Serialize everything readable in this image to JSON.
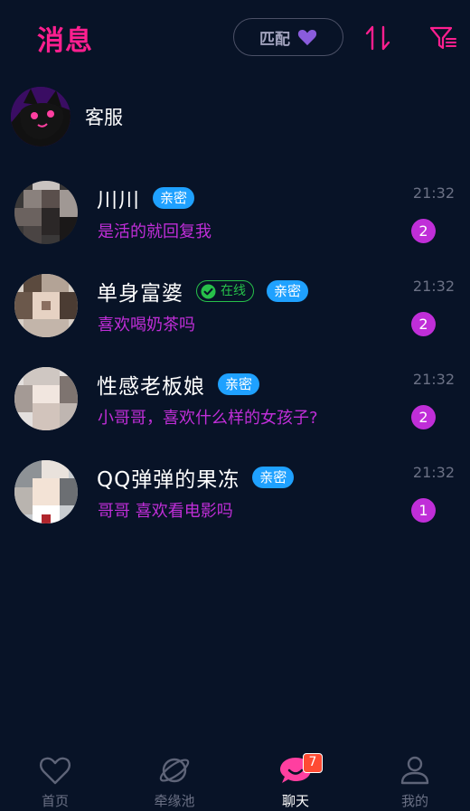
{
  "header": {
    "title": "消息",
    "match_label": "匹配",
    "accent": "#ff1f8f"
  },
  "service": {
    "name": "客服"
  },
  "conversations": [
    {
      "name": "川川",
      "online": false,
      "tag": "亲密",
      "message": "是活的就回复我",
      "time": "21:32",
      "unread": "2"
    },
    {
      "name": "单身富婆",
      "online": true,
      "online_label": "在线",
      "tag": "亲密",
      "message": "喜欢喝奶茶吗",
      "time": "21:32",
      "unread": "2"
    },
    {
      "name": "性感老板娘",
      "online": false,
      "tag": "亲密",
      "message": "小哥哥，喜欢什么样的女孩子?",
      "time": "21:32",
      "unread": "2"
    },
    {
      "name": "QQ弹弹的果冻",
      "online": false,
      "tag": "亲密",
      "message": "哥哥 喜欢看电影吗",
      "time": "21:32",
      "unread": "1"
    }
  ],
  "tabbar": {
    "items": [
      {
        "label": "首页",
        "icon": "heart-icon"
      },
      {
        "label": "牵缘池",
        "icon": "planet-icon"
      },
      {
        "label": "聊天",
        "icon": "chat-icon",
        "badge": "7",
        "active": true
      },
      {
        "label": "我的",
        "icon": "person-icon"
      }
    ]
  },
  "colors": {
    "background": "#081327",
    "message_text": "#c02ed8",
    "tag_blue": "#1fa1ff",
    "online_green": "#27c04a",
    "muted": "#6b7185"
  }
}
